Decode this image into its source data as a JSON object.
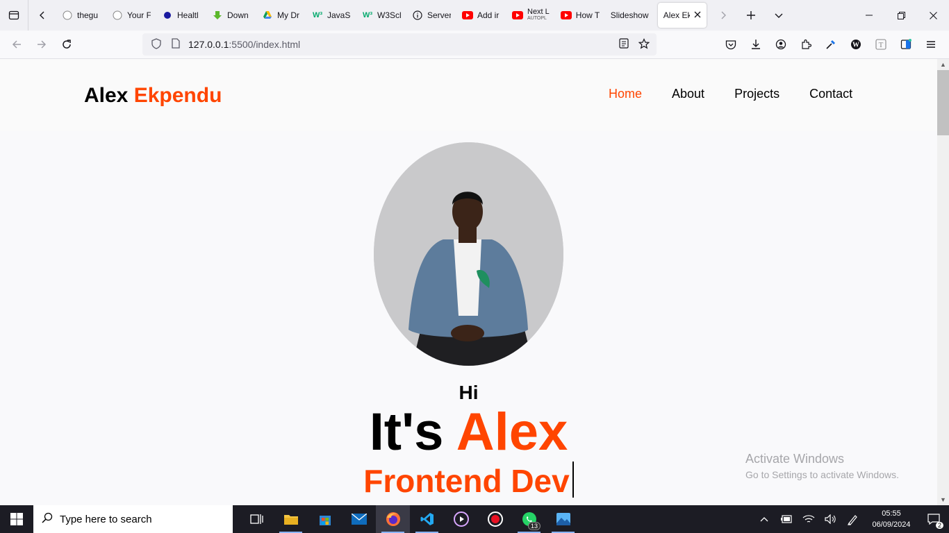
{
  "browser": {
    "tabs": [
      {
        "label": "thegu",
        "icon": "github-icon"
      },
      {
        "label": "Your F",
        "icon": "github-icon"
      },
      {
        "label": "Healtl",
        "icon": "circle-icon"
      },
      {
        "label": "Down",
        "icon": "download-arrow-icon"
      },
      {
        "label": "My Dr",
        "icon": "google-drive-icon"
      },
      {
        "label": "JavaSc",
        "icon": "w3schools-icon"
      },
      {
        "label": "W3Scl",
        "icon": "w3schools-icon"
      },
      {
        "label": "Server",
        "icon": "info-icon"
      },
      {
        "label": "Add ir",
        "icon": "youtube-icon"
      },
      {
        "label": "Next L",
        "sublabel": "AUTOPL",
        "icon": "youtube-icon"
      },
      {
        "label": "How T",
        "icon": "youtube-icon"
      },
      {
        "label": "Slideshow",
        "icon": ""
      },
      {
        "label": "Alex Ek",
        "icon": "",
        "active": true
      }
    ],
    "url_host": "127.0.0.1",
    "url_path": ":5500/index.html"
  },
  "site": {
    "logo_first": "Alex",
    "logo_second": "Ekpendu",
    "nav": [
      "Home",
      "About",
      "Projects",
      "Contact"
    ],
    "greeting": "Hi",
    "headline_prefix": "It's",
    "headline_name": "Alex",
    "role": "Frontend Dev"
  },
  "colors": {
    "accent": "#ff4500",
    "text": "#000000",
    "background": "#fafafa"
  },
  "watermark": {
    "title": "Activate Windows",
    "subtitle": "Go to Settings to activate Windows."
  },
  "taskbar": {
    "search_placeholder": "Type here to search",
    "whatsapp_badge": "13",
    "time": "05:55",
    "date": "06/09/2024",
    "notifications": "2"
  }
}
